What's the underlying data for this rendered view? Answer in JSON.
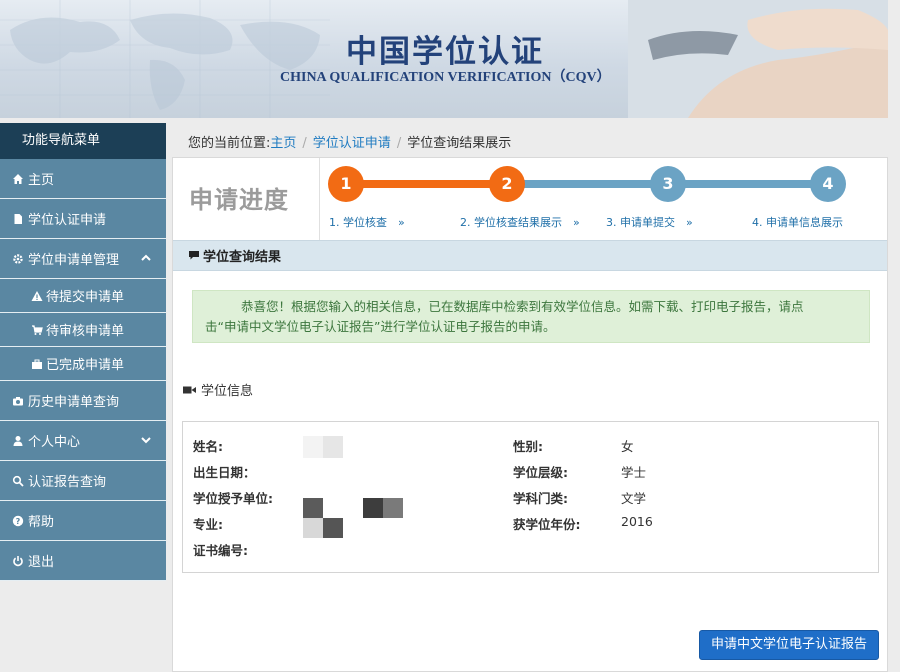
{
  "header": {
    "title": "中国学位认证",
    "subtitle": "CHINA QUALIFICATION VERIFICATION（CQV）"
  },
  "sidebar": {
    "title": "功能导航菜单",
    "items": [
      {
        "label": "主页",
        "icon": "home-icon"
      },
      {
        "label": "学位认证申请",
        "icon": "document-icon"
      },
      {
        "label": "学位申请单管理",
        "icon": "gear-icon",
        "expanded": true,
        "children": [
          {
            "label": "待提交申请单",
            "icon": "warning-icon"
          },
          {
            "label": "待审核申请单",
            "icon": "cart-icon"
          },
          {
            "label": "已完成申请单",
            "icon": "briefcase-icon"
          }
        ]
      },
      {
        "label": "历史申请单查询",
        "icon": "camera-icon"
      },
      {
        "label": "个人中心",
        "icon": "user-icon",
        "expanded": false
      },
      {
        "label": "认证报告查询",
        "icon": "search-icon"
      },
      {
        "label": "帮助",
        "icon": "help-icon"
      },
      {
        "label": "退出",
        "icon": "power-icon"
      }
    ]
  },
  "breadcrumb": {
    "prefix": "您的当前位置:",
    "links": [
      "主页",
      "学位认证申请"
    ],
    "current": "学位查询结果展示"
  },
  "progress": {
    "label": "申请进度",
    "steps": [
      {
        "number": "1",
        "label": "1. 学位核查　»",
        "state": "done"
      },
      {
        "number": "2",
        "label": "2. 学位核查结果展示　»",
        "state": "current"
      },
      {
        "number": "3",
        "label": "3. 申请单提交　»",
        "state": "pending"
      },
      {
        "number": "4",
        "label": "4. 申请单信息展示",
        "state": "pending"
      }
    ],
    "colors": {
      "active": "#f26b14",
      "inactive": "#6ba3c4"
    }
  },
  "result": {
    "section_title": "学位查询结果",
    "message_line1": "恭喜您！根据您输入的相关信息，已在数据库中检索到有效学位信息。如需下载、打印电子报告，请点",
    "message_line2": "击“申请中文学位电子认证报告”进行学位认证电子报告的申请。"
  },
  "degree_info": {
    "section_title": "学位信息",
    "left_fields": [
      {
        "label": "姓名:",
        "value": ""
      },
      {
        "label": "出生日期：",
        "value": ""
      },
      {
        "label": "学位授予单位:",
        "value": ""
      },
      {
        "label": "专业:",
        "value": ""
      },
      {
        "label": "证书编号:",
        "value": ""
      }
    ],
    "right_fields": [
      {
        "label": "性别:",
        "value": "女"
      },
      {
        "label": "学位层级:",
        "value": "学士"
      },
      {
        "label": "学科门类:",
        "value": "文学"
      },
      {
        "label": "获学位年份:",
        "value": "2016"
      }
    ]
  },
  "actions": {
    "apply_report": "申请中文学位电子认证报告"
  }
}
